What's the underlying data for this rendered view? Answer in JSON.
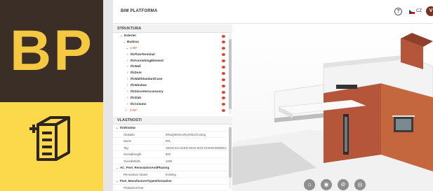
{
  "brand": {
    "letters": "BP"
  },
  "header": {
    "app_title": "BIM PLATFORMA",
    "help_glyph": "?",
    "language": "CZ",
    "avatar_initial": "V"
  },
  "structure": {
    "title": "STRUKTURA",
    "items": [
      {
        "label": "Exterier",
        "chev": "⌄"
      },
      {
        "label": "Budova",
        "chev": "⌄"
      },
      {
        "label": "1.NP",
        "chev": "⌄"
      },
      {
        "label": "IfcFlowTerminal",
        "chev": "›"
      },
      {
        "label": "IfcFurnishingElement",
        "chev": "›"
      },
      {
        "label": "IfcWall",
        "chev": "›"
      },
      {
        "label": "IfcDoor",
        "chev": "›"
      },
      {
        "label": "IfcWallStandardCase",
        "chev": "›"
      },
      {
        "label": "IfcWindow",
        "chev": "›"
      },
      {
        "label": "IfcDiscreteAccessory",
        "chev": "›"
      },
      {
        "label": "IfcSlab",
        "chev": "›"
      },
      {
        "label": "IfcColumn",
        "chev": "›"
      },
      {
        "label": "2.NP",
        "chev": "›"
      }
    ]
  },
  "properties": {
    "title": "VLASTNOSTI",
    "groups": [
      {
        "label": "IfcWindow",
        "rows": [
          {
            "key": "GlobalId",
            "value": "0RwQrkHGuVEyX0ScOCvZog"
          },
          {
            "key": "Name",
            "value": "001"
          },
          {
            "key": "Tag",
            "value": "1B43C414-41ED-4D42-8101-EC832CB30EEA"
          },
          {
            "key": "OverallHeight",
            "value": "900"
          },
          {
            "key": "OverallWidth",
            "value": "1000"
          }
        ]
      },
      {
        "label": "AC_Pset_RenovationAndPhasing",
        "rows": [
          {
            "key": "Renovation Status",
            "value": "Existing"
          }
        ]
      },
      {
        "label": "Pset_ManufacturerTypeInformation",
        "rows": [
          {
            "key": "ProductionYear",
            "value": ""
          }
        ]
      }
    ]
  },
  "viewer_buttons": [
    {
      "icon": "home-icon",
      "glyph": "⌂"
    },
    {
      "icon": "eye-icon",
      "glyph": "◉"
    },
    {
      "icon": "eye-off-icon",
      "glyph": "⊘"
    },
    {
      "icon": "target-icon",
      "glyph": "◎"
    }
  ],
  "colors": {
    "brand_dark": "#3a2e27",
    "brand_yellow": "#fcd94a",
    "accent_red": "#e0432d",
    "brick": "#b5553a"
  }
}
